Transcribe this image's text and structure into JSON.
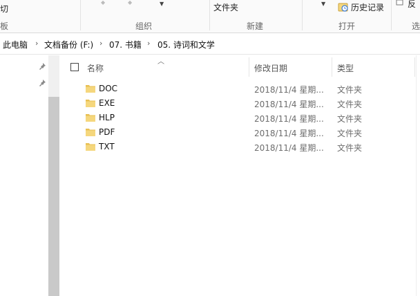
{
  "ribbon": {
    "left_group_partial": "板",
    "left_top_partial": "切",
    "organize_group": "组织",
    "new_group": "新建",
    "new_folder_label": "文件夹",
    "open_group": "打开",
    "history_label": "历史记录",
    "select_group_partial": "选",
    "select_top_partial": "反"
  },
  "breadcrumb": {
    "items": [
      "此电脑",
      "文档备份 (F:)",
      "07. 书籍",
      "05. 诗词和文学"
    ]
  },
  "columns": {
    "name": "名称",
    "date": "修改日期",
    "type": "类型"
  },
  "files": [
    {
      "name": "DOC",
      "date": "2018/11/4 星期...",
      "type": "文件夹"
    },
    {
      "name": "EXE",
      "date": "2018/11/4 星期...",
      "type": "文件夹"
    },
    {
      "name": "HLP",
      "date": "2018/11/4 星期...",
      "type": "文件夹"
    },
    {
      "name": "PDF",
      "date": "2018/11/4 星期...",
      "type": "文件夹"
    },
    {
      "name": "TXT",
      "date": "2018/11/4 星期...",
      "type": "文件夹"
    }
  ],
  "icons": {
    "folder": "folder-icon",
    "pin": "pin-icon",
    "history": "history-icon",
    "chevron": "chevron-right-icon"
  },
  "colors": {
    "folder": "#f5d77d",
    "folder_dark": "#e8bf52",
    "accent": "#1a73c8"
  }
}
